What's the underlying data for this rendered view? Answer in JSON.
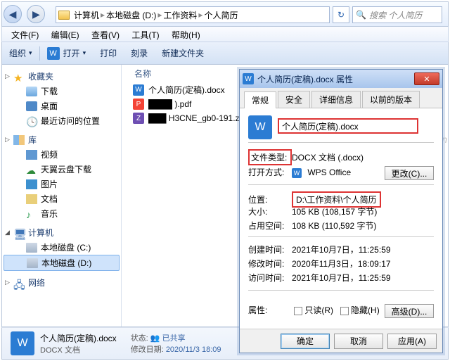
{
  "watermark": "ITmemo.cn",
  "breadcrumbs": [
    "计算机",
    "本地磁盘 (D:)",
    "工作资料",
    "个人简历"
  ],
  "search_placeholder": "搜索 个人简历",
  "menus": [
    "文件(F)",
    "编辑(E)",
    "查看(V)",
    "工具(T)",
    "帮助(H)"
  ],
  "toolbar": {
    "org": "组织",
    "open": "打开",
    "print": "打印",
    "burn": "刻录",
    "newfolder": "新建文件夹"
  },
  "nav": {
    "fav": {
      "hd": "收藏夹",
      "items": [
        "下载",
        "桌面",
        "最近访问的位置"
      ]
    },
    "lib": {
      "hd": "库",
      "items": [
        "视频",
        "天翼云盘下载",
        "图片",
        "文档",
        "音乐"
      ]
    },
    "comp": {
      "hd": "计算机",
      "items": [
        "本地磁盘 (C:)",
        "本地磁盘 (D:)"
      ]
    },
    "net": {
      "hd": "网络"
    }
  },
  "list": {
    "header": "名称",
    "files": [
      {
        "ico": "docx",
        "name": "个人简历(定稿).docx"
      },
      {
        "ico": "pdf",
        "name": "████ ).pdf"
      },
      {
        "ico": "zip",
        "name": "███ H3CNE_gb0-191.zip"
      }
    ]
  },
  "details": {
    "name": "个人简历(定稿).docx",
    "type": "DOCX 文档",
    "status_k": "状态:",
    "status_v": "已共享",
    "mod_k": "修改日期:",
    "mod_v": "2020/11/3 18:09"
  },
  "dialog": {
    "title": "个人简历(定稿).docx 属性",
    "tabs": [
      "常规",
      "安全",
      "详细信息",
      "以前的版本"
    ],
    "filename": "个人简历(定稿).docx",
    "rows": {
      "type_k": "文件类型:",
      "type_v": "DOCX 文档 (.docx)",
      "open_k": "打开方式:",
      "open_v": "WPS Office",
      "change": "更改(C)...",
      "loc_k": "位置:",
      "loc_v": "D:\\工作资料\\个人简历",
      "size_k": "大小:",
      "size_v": "105 KB (108,157 字节)",
      "disk_k": "占用空间:",
      "disk_v": "108 KB (110,592 字节)",
      "ct_k": "创建时间:",
      "ct_v": "2021年10月7日，11:25:59",
      "mt_k": "修改时间:",
      "mt_v": "2020年11月3日，18:09:17",
      "at_k": "访问时间:",
      "at_v": "2021年10月7日，11:25:59",
      "attr_k": "属性:",
      "ro": "只读(R)",
      "hid": "隐藏(H)",
      "adv": "高级(D)..."
    },
    "btns": {
      "ok": "确定",
      "cancel": "取消",
      "apply": "应用(A)"
    }
  }
}
